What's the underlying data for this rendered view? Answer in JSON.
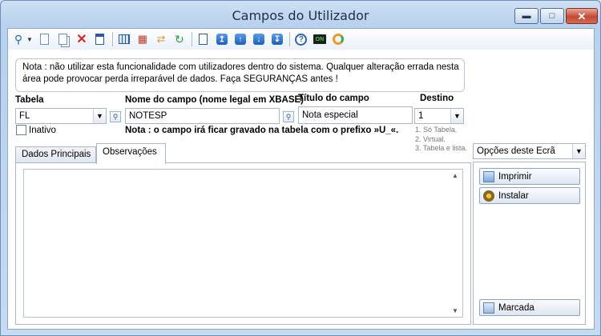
{
  "window": {
    "title": "Campos do Utilizador"
  },
  "toolbar": {
    "icons": [
      "search-icon",
      "new-document-icon",
      "copy-document-icon",
      "delete-icon",
      "properties-icon",
      "table-icon",
      "tree-icon",
      "swap-icon",
      "refresh-icon",
      "preview-icon",
      "move-top-icon",
      "move-up-icon",
      "move-down-icon",
      "move-bottom-icon",
      "help-icon",
      "on-icon",
      "sync-icon"
    ]
  },
  "note": {
    "text": "Nota : não utilizar esta funcionalidade com utilizadores dentro do sistema. Qualquer alteração errada nesta área pode provocar perda irreparável de dados. Faça SEGURANÇAS antes !"
  },
  "form": {
    "tabela_label": "Tabela",
    "tabela_value": "FL",
    "nome_label": "Nome do campo (nome legal em XBASE)",
    "nome_value": "NOTESP",
    "titulo_label": "Título do campo",
    "titulo_value": "Nota especial",
    "destino_label": "Destino",
    "destino_value": "1",
    "destino_options": [
      "1. Só Tabela.",
      "2. Virtual.",
      "3. Tabela e lista."
    ],
    "inativo_label": "Inativo",
    "prefix_note": "Nota : o campo irá ficar gravado na tabela com o prefixo »U_«."
  },
  "tabs": [
    {
      "label": "Dados Principais"
    },
    {
      "label": "Observações"
    }
  ],
  "options": {
    "select_value": "Opções deste Ecrã",
    "buttons": [
      {
        "label": "Imprimir"
      },
      {
        "label": "Instalar"
      },
      {
        "label": "Marcada"
      }
    ]
  }
}
